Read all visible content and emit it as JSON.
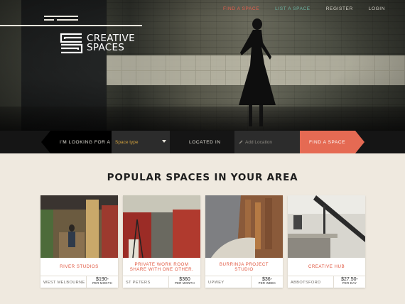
{
  "nav": {
    "find_space": "FIND A SPACE",
    "list_space": "LIST A SPACE",
    "register": "REGISTER",
    "login": "LOGIN"
  },
  "logo": {
    "line1": "CREATIVE",
    "line2": "SPACES"
  },
  "search": {
    "looking_label": "I'M LOOKING FOR A",
    "space_type_value": "Space type",
    "located_label": "LOCATED IN",
    "location_placeholder": "Add Location",
    "submit_label": "FIND A SPACE"
  },
  "heading": "POPULAR SPACES IN YOUR AREA",
  "cards": [
    {
      "title": "RIVER STUDIOS",
      "location": "WEST MELBOURNE",
      "price": "$190-",
      "period": "PER MONTH"
    },
    {
      "title": "PRIVATE WORK ROOM SHARE WITH ONE OTHER.",
      "location": "ST PETERS",
      "price": "$360",
      "period": "PER MONTH"
    },
    {
      "title": "BURRINJA PROJECT STUDIO",
      "location": "UPWEY",
      "price": "$36-",
      "period": "PER WEEK"
    },
    {
      "title": "CREATIVE HUB",
      "location": "ABBOTSFORD",
      "price": "$27.50-",
      "period": "PER DAY"
    }
  ],
  "colors": {
    "accent": "#e56a53",
    "teal": "#6fb8a6",
    "gold": "#d3a23d",
    "background": "#efe9df"
  },
  "icons": [
    "menu-lines-icon",
    "logo-mark-icon",
    "pencil-icon",
    "dropdown-caret-icon"
  ]
}
